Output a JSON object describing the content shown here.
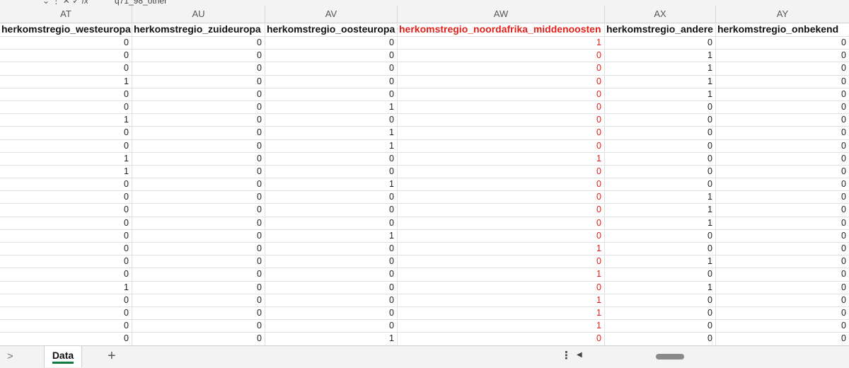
{
  "formula_bar": {
    "tools": "⌄ ⋮ ✕ ✓ fx",
    "value": "q71_98_other"
  },
  "columns": [
    "AT",
    "AU",
    "AV",
    "AW",
    "AX",
    "AY"
  ],
  "headers": [
    "herkomstregio_westeuropa",
    "herkomstregio_zuideuropa",
    "herkomstregio_oosteuropa",
    "herkomstregio_noordafrika_middenoosten",
    "herkomstregio_andere",
    "herkomstregio_onbekend"
  ],
  "highlight_color": "#e0201b",
  "rows": [
    [
      "0",
      "0",
      "0",
      "1",
      "0",
      "0"
    ],
    [
      "0",
      "0",
      "0",
      "0",
      "1",
      "0"
    ],
    [
      "0",
      "0",
      "0",
      "0",
      "1",
      "0"
    ],
    [
      "1",
      "0",
      "0",
      "0",
      "1",
      "0"
    ],
    [
      "0",
      "0",
      "0",
      "0",
      "1",
      "0"
    ],
    [
      "0",
      "0",
      "1",
      "0",
      "0",
      "0"
    ],
    [
      "1",
      "0",
      "0",
      "0",
      "0",
      "0"
    ],
    [
      "0",
      "0",
      "1",
      "0",
      "0",
      "0"
    ],
    [
      "0",
      "0",
      "1",
      "0",
      "0",
      "0"
    ],
    [
      "1",
      "0",
      "0",
      "1",
      "0",
      "0"
    ],
    [
      "1",
      "0",
      "0",
      "0",
      "0",
      "0"
    ],
    [
      "0",
      "0",
      "1",
      "0",
      "0",
      "0"
    ],
    [
      "0",
      "0",
      "0",
      "0",
      "1",
      "0"
    ],
    [
      "0",
      "0",
      "0",
      "0",
      "1",
      "0"
    ],
    [
      "0",
      "0",
      "0",
      "0",
      "1",
      "0"
    ],
    [
      "0",
      "0",
      "1",
      "0",
      "0",
      "0"
    ],
    [
      "0",
      "0",
      "0",
      "1",
      "0",
      "0"
    ],
    [
      "0",
      "0",
      "0",
      "0",
      "1",
      "0"
    ],
    [
      "0",
      "0",
      "0",
      "1",
      "0",
      "0"
    ],
    [
      "1",
      "0",
      "0",
      "0",
      "1",
      "0"
    ],
    [
      "0",
      "0",
      "0",
      "1",
      "0",
      "0"
    ],
    [
      "0",
      "0",
      "0",
      "1",
      "0",
      "0"
    ],
    [
      "0",
      "0",
      "0",
      "1",
      "0",
      "0"
    ],
    [
      "0",
      "0",
      "1",
      "0",
      "0",
      "0"
    ]
  ],
  "tabbar": {
    "nav_arrow": ">",
    "sheet_name": "Data",
    "add_sheet": "+",
    "more": "⋮",
    "scroll_left": "◀"
  }
}
